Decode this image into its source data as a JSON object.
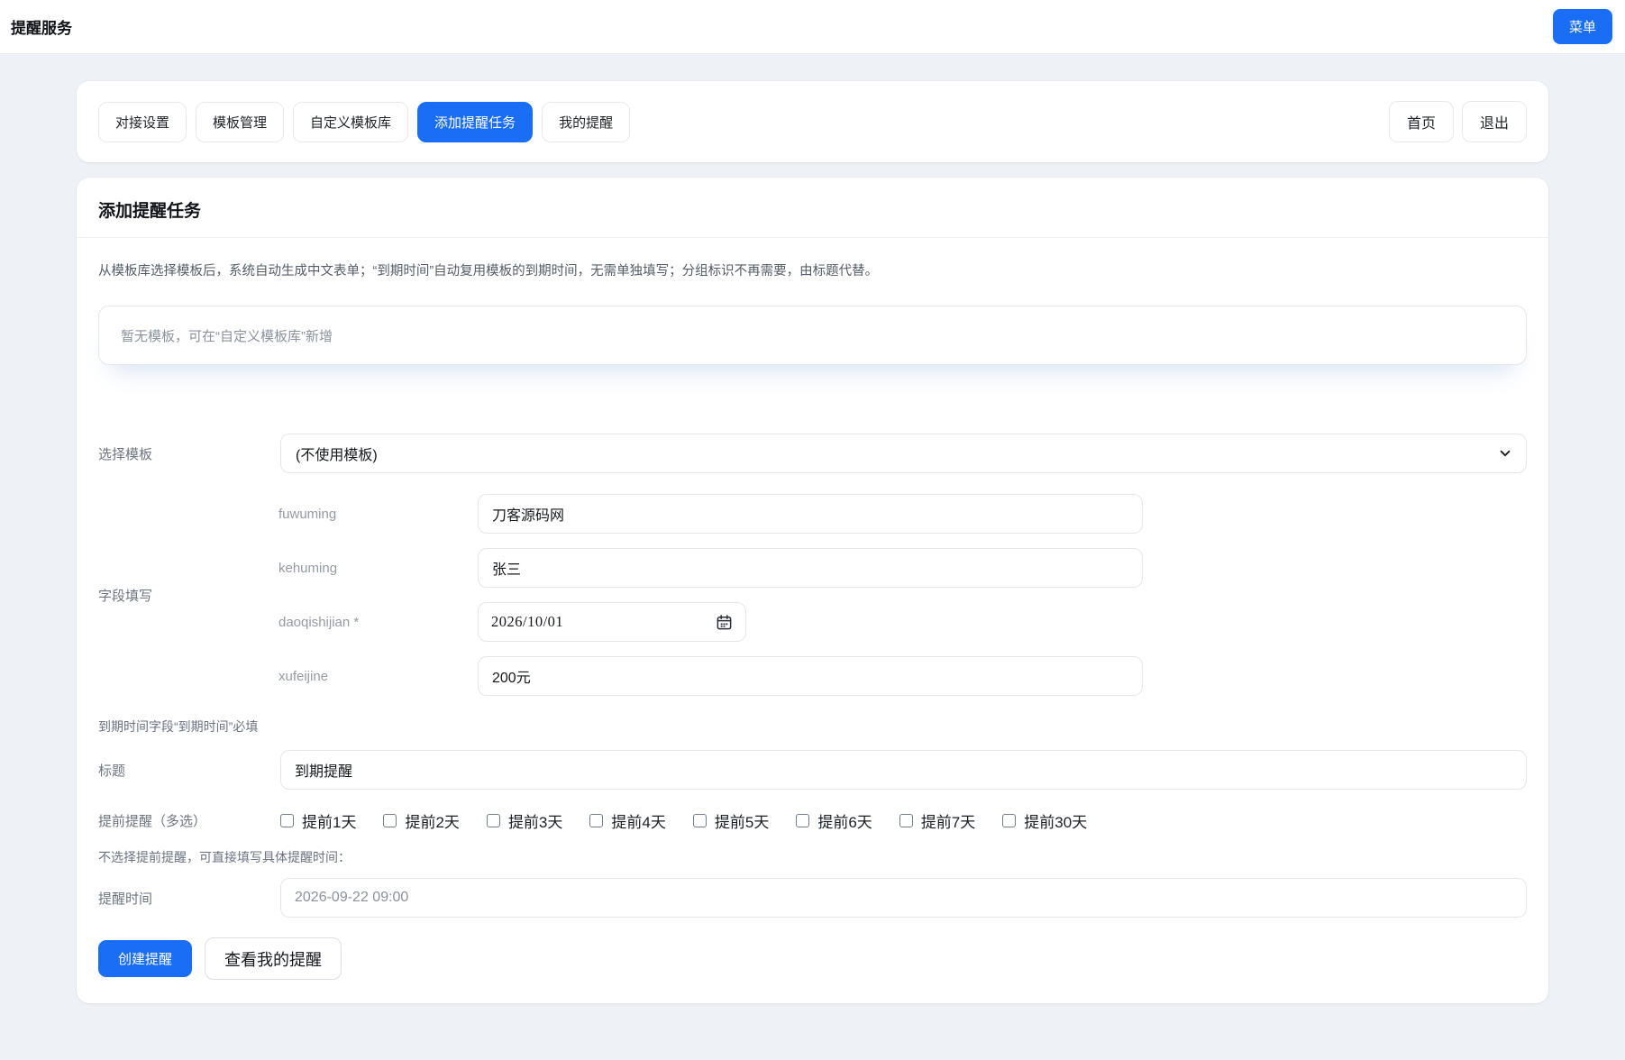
{
  "colors": {
    "accent": "#1a6df5"
  },
  "header": {
    "title": "提醒服务",
    "menu_button": "菜单"
  },
  "nav": {
    "tabs": [
      {
        "label": "对接设置",
        "active": false
      },
      {
        "label": "模板管理",
        "active": false
      },
      {
        "label": "自定义模板库",
        "active": false
      },
      {
        "label": "添加提醒任务",
        "active": true
      },
      {
        "label": "我的提醒",
        "active": false
      }
    ],
    "home_button": "首页",
    "logout_button": "退出"
  },
  "panel": {
    "title": "添加提醒任务",
    "description": "从模板库选择模板后，系统自动生成中文表单；“到期时间”自动复用模板的到期时间，无需单独填写；分组标识不再需要，由标题代替。",
    "empty_template_notice": "暂无模板，可在“自定义模板库”新增",
    "form": {
      "template_select": {
        "label": "选择模板",
        "value": "(不使用模板)"
      },
      "fields_group": {
        "label": "字段填写",
        "fields": [
          {
            "label": "fuwuming",
            "value": "刀客源码网",
            "type": "text"
          },
          {
            "label": "kehuming",
            "value": "张三",
            "type": "text"
          },
          {
            "label": "daoqishijian *",
            "value": "2026/10/01",
            "type": "date"
          },
          {
            "label": "xufeijine",
            "value": "200元",
            "type": "text"
          }
        ]
      },
      "due_note": "到期时间字段“到期时间”必填",
      "title_field": {
        "label": "标题",
        "value": "到期提醒"
      },
      "advance_reminder": {
        "label": "提前提醒（多选）",
        "options": [
          "提前1天",
          "提前2天",
          "提前3天",
          "提前4天",
          "提前5天",
          "提前6天",
          "提前7天",
          "提前30天"
        ],
        "checked": []
      },
      "custom_time_note": "不选择提前提醒，可直接填写具体提醒时间：",
      "remind_time": {
        "label": "提醒时间",
        "placeholder": "2026-09-22 09:00"
      },
      "create_button": "创建提醒",
      "view_my_button": "查看我的提醒"
    }
  }
}
